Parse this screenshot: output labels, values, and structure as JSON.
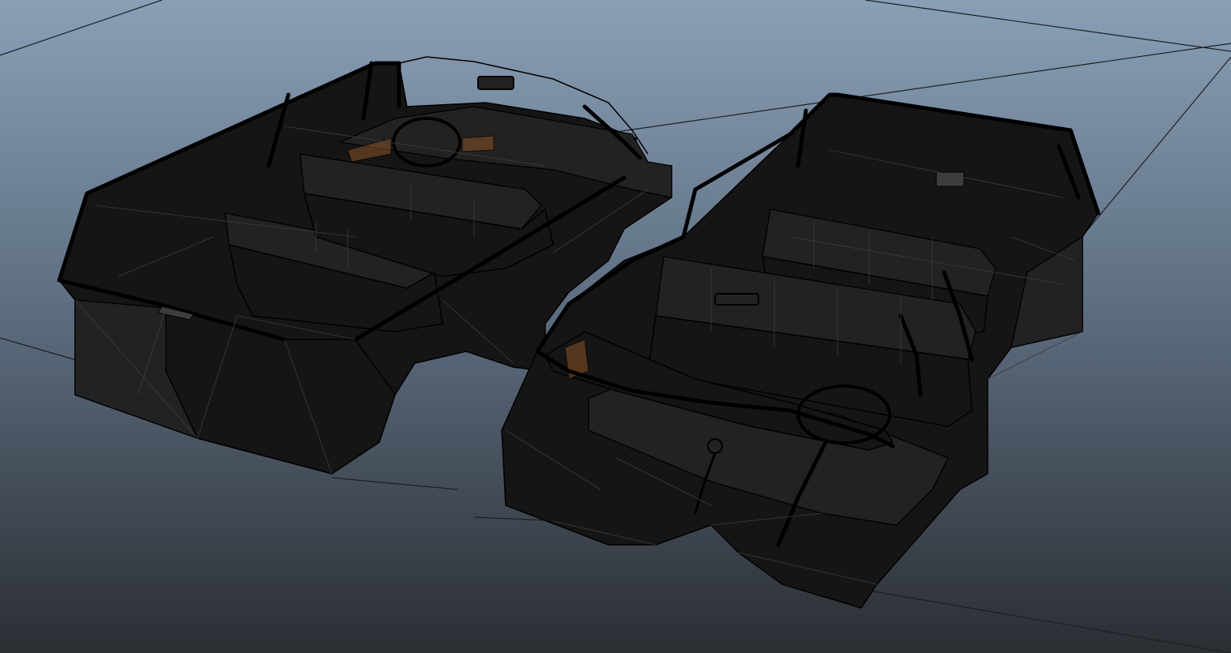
{
  "viewport": {
    "background_top": "#8a9fb6",
    "background_mid": "#5f7083",
    "background_bottom": "#2b2e33",
    "grid_line_color": "#1b1f24",
    "mesh_fill": "#151515",
    "mesh_fill_light": "#222222",
    "wire_color": "#3d3d3d",
    "edge_color": "#000000",
    "dash_accent": "#8a5226"
  },
  "scene": {
    "objects": [
      {
        "name": "car-interior-mesh-left",
        "type": "polygon-mesh",
        "view": "wireframe-on-shaded"
      },
      {
        "name": "car-interior-mesh-right",
        "type": "polygon-mesh",
        "view": "wireframe-on-shaded"
      }
    ]
  }
}
